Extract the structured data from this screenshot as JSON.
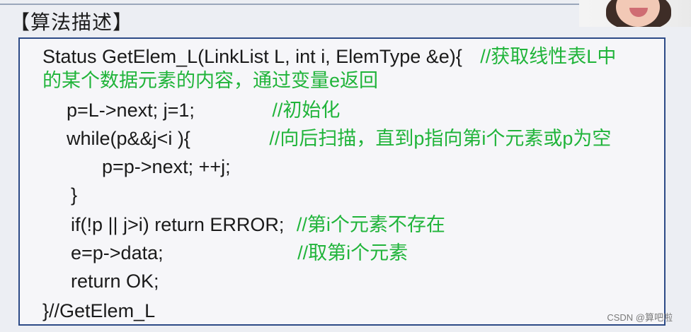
{
  "header": {
    "title": "【算法描述】"
  },
  "code": {
    "line1_code": "Status GetElem_L(LinkList L, int i, ElemType &e){",
    "line1_comment": "//获取线性表L中",
    "line2_comment": "的某个数据元素的内容，通过变量e返回",
    "line3_code": "p=L->next; j=1;",
    "line3_comment": "//初始化",
    "line4_code": "while(p&&j<i ){",
    "line4_comment": "//向后扫描，直到p指向第i个元素或p为空",
    "line5_code": "p=p->next; ++j;",
    "line6_code": "}",
    "line7_code": "if(!p || j>i)  return ERROR;",
    "line7_comment": "//第i个元素不存在",
    "line8_code": "e=p->data;",
    "line8_comment": "//取第i个元素",
    "line9_code": "return OK;",
    "line10_code": "}//GetElem_L"
  },
  "footer": {
    "watermark": "CSDN @算吧啦"
  },
  "colors": {
    "comment": "#20b43a",
    "border": "#2c4a86"
  }
}
